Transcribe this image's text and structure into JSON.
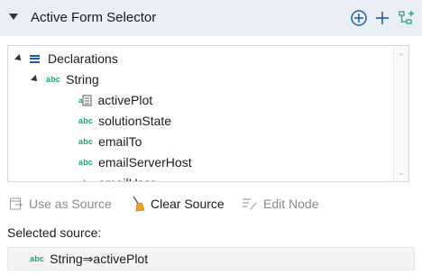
{
  "section": {
    "title": "Active Form Selector"
  },
  "tree": {
    "root": {
      "label": "Declarations",
      "icon": "declarations-list-icon"
    },
    "group": {
      "label": "String",
      "icon": "abc"
    },
    "items": [
      {
        "label": "activePlot",
        "icon": "abc-form"
      },
      {
        "label": "solutionState",
        "icon": "abc"
      },
      {
        "label": "emailTo",
        "icon": "abc"
      },
      {
        "label": "emailServerHost",
        "icon": "abc"
      },
      {
        "label": "emailUser",
        "icon": "abc"
      }
    ],
    "abc_text": "abc"
  },
  "toolbar": {
    "use_source": "Use as Source",
    "clear_source": "Clear Source",
    "edit_node": "Edit Node"
  },
  "selected": {
    "label": "Selected source:",
    "value": "String⇒activePlot"
  },
  "colors": {
    "header_bg": "#e9eef5",
    "accent_blue": "#1d5fa8",
    "abc_green": "#1aa179"
  }
}
